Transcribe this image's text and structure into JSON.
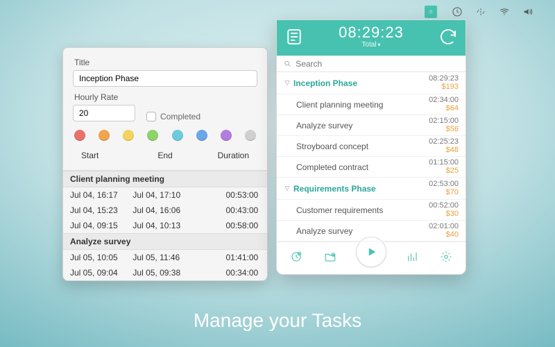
{
  "menubar": {
    "active_icon": "timer-icon"
  },
  "editor": {
    "title_label": "Title",
    "title_value": "Inception Phase",
    "rate_label": "Hourly Rate",
    "rate_value": "20",
    "completed_label": "Completed",
    "colors": [
      "#e8726a",
      "#f0a54e",
      "#f4d35e",
      "#8ed26b",
      "#6ecbdc",
      "#6aa7e8",
      "#b07de0",
      "#d0d0d0"
    ],
    "columns": {
      "start": "Start",
      "end": "End",
      "duration": "Duration"
    },
    "groups": [
      {
        "name": "Client planning meeting",
        "rows": [
          {
            "start": "Jul 04, 16:17",
            "end": "Jul 04, 17:10",
            "dur": "00:53:00"
          },
          {
            "start": "Jul 04, 15:23",
            "end": "Jul 04, 16:06",
            "dur": "00:43:00"
          },
          {
            "start": "Jul 04, 09:15",
            "end": "Jul 04, 10:13",
            "dur": "00:58:00"
          }
        ]
      },
      {
        "name": "Analyze survey",
        "rows": [
          {
            "start": "Jul 05, 10:05",
            "end": "Jul 05, 11:46",
            "dur": "01:41:00"
          },
          {
            "start": "Jul 05, 09:04",
            "end": "Jul 05, 09:38",
            "dur": "00:34:00"
          }
        ]
      }
    ]
  },
  "tracker": {
    "time": "08:29:23",
    "total_label": "Total",
    "search_placeholder": "Search",
    "projects": [
      {
        "name": "Inception Phase",
        "time": "08:29:23",
        "money": "$193",
        "tasks": [
          {
            "name": "Client planning meeting",
            "time": "02:34:00",
            "money": "$64",
            "mark": "green"
          },
          {
            "name": "Analyze survey",
            "time": "02:15:00",
            "money": "$56",
            "mark": "blue"
          },
          {
            "name": "Stroyboard concept",
            "time": "02:25:23",
            "money": "$48"
          },
          {
            "name": "Completed contract",
            "time": "01:15:00",
            "money": "$25"
          }
        ]
      },
      {
        "name": "Requirements Phase",
        "time": "02:53:00",
        "money": "$70",
        "tasks": [
          {
            "name": "Customer requirements",
            "time": "00:52:00",
            "money": "$30",
            "mark": "red"
          },
          {
            "name": "Analyze survey",
            "time": "02:01:00",
            "money": "$40"
          }
        ]
      }
    ]
  },
  "caption": "Manage your Tasks"
}
